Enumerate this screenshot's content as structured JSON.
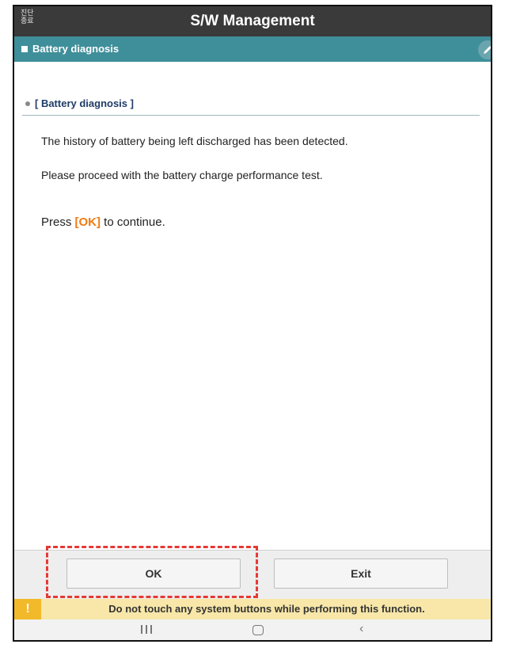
{
  "titlebar": {
    "end_diag_line1": "진단",
    "end_diag_line2": "종료",
    "title": "S/W Management"
  },
  "subheader": {
    "label": "Battery diagnosis",
    "edit_icon": "pencil-icon"
  },
  "content": {
    "section_title": "[ Battery diagnosis ]",
    "line1": "The history of battery being left discharged has been detected.",
    "line2": "Please proceed with the battery charge performance test.",
    "press_prefix": "Press ",
    "press_ok": "[OK]",
    "press_suffix": " to continue."
  },
  "buttons": {
    "ok_label": "OK",
    "exit_label": "Exit"
  },
  "warning": {
    "icon": "!",
    "text": "Do not touch any system buttons while performing this function."
  },
  "navbar": {
    "recents_icon": "recents-icon",
    "home_icon": "home-icon",
    "back_icon": "back-icon"
  },
  "colors": {
    "titlebar": "#3a3a3a",
    "subheader": "#3f8f9a",
    "ok_accent": "#f07a12",
    "warning_bg": "#f8e7a8",
    "highlight": "#e53935"
  }
}
